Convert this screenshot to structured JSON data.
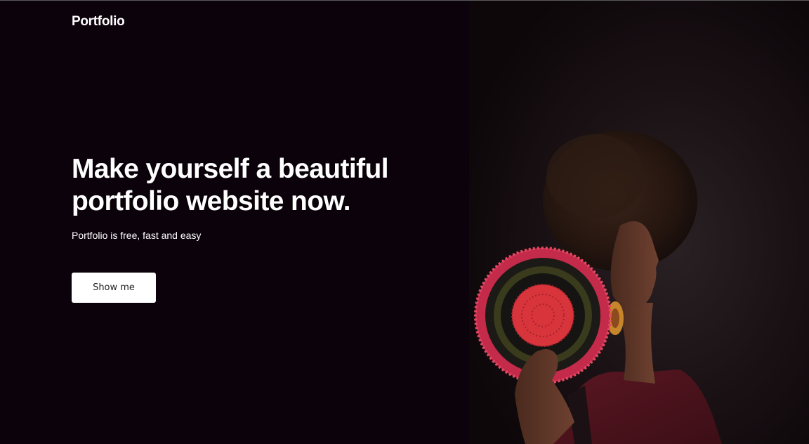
{
  "brand": {
    "logo_text": "Portfolio"
  },
  "hero": {
    "headline_line1": "Make yourself a beautiful",
    "headline_line2": "portfolio website now.",
    "subtitle": "Portfolio is free, fast and easy",
    "cta_label": "Show me"
  },
  "colors": {
    "background": "#0c020b",
    "text": "#ffffff",
    "button_bg": "#ffffff",
    "button_text": "#222222",
    "accent_red": "#d8343c"
  }
}
